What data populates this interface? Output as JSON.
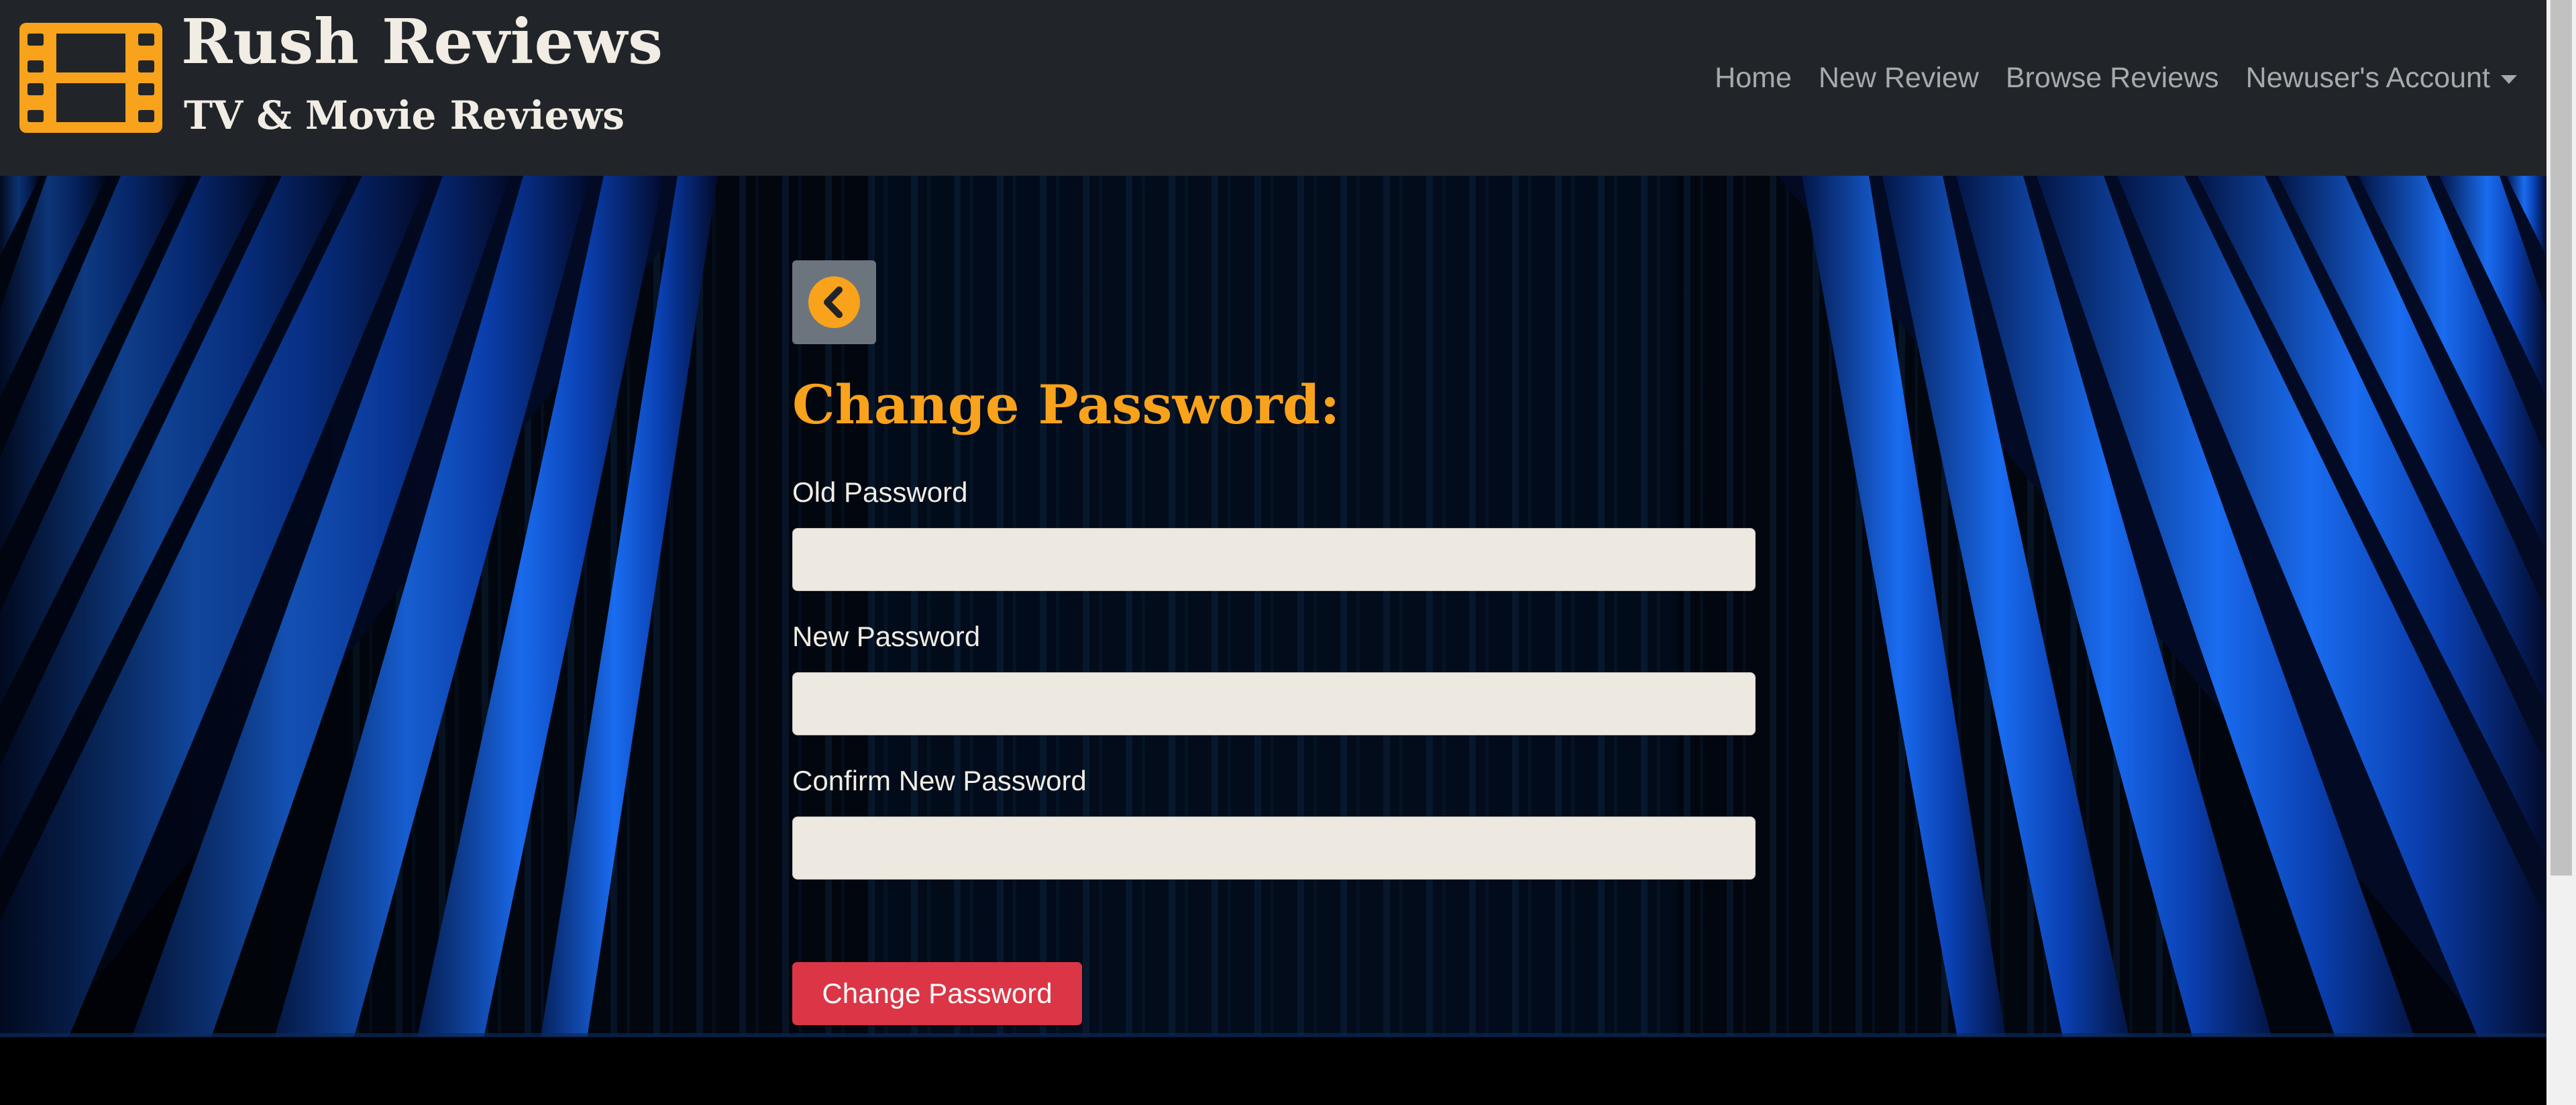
{
  "brand": {
    "title": "Rush Reviews",
    "subtitle": "TV & Movie Reviews",
    "logo_icon": "film-strip-icon",
    "accent_color": "#f9a21b"
  },
  "nav": {
    "items": [
      {
        "label": "Home"
      },
      {
        "label": "New Review"
      },
      {
        "label": "Browse Reviews"
      },
      {
        "label": "Newuser's Account"
      }
    ]
  },
  "form": {
    "back_icon": "chevron-left-icon",
    "title": "Change Password:",
    "fields": [
      {
        "label": "Old Password",
        "value": ""
      },
      {
        "label": "New Password",
        "value": ""
      },
      {
        "label": "Confirm New Password",
        "value": ""
      }
    ],
    "submit_label": "Change Password",
    "submit_color": "#dc3545"
  },
  "background": {
    "curtain_color": "#0a46c8",
    "navbar_color": "#212529"
  }
}
